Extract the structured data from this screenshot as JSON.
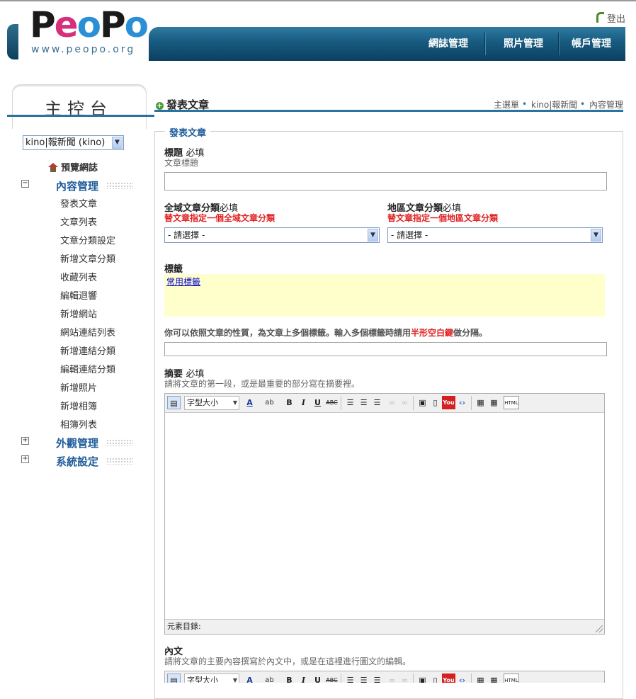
{
  "logo": {
    "word": [
      "P",
      "e",
      "o",
      "P",
      "o"
    ],
    "url": "www.peopo.org"
  },
  "header": {
    "logout": "登出",
    "nav": [
      "網誌管理",
      "照片管理",
      "帳戶管理"
    ]
  },
  "sidebar": {
    "title": "主控台",
    "blog_select": "kino|報新聞 (kino)",
    "preview": "預覽網誌",
    "sections": [
      {
        "label": "內容管理",
        "toggle": "−",
        "expanded": true
      },
      {
        "label": "外觀管理",
        "toggle": "+",
        "expanded": false
      },
      {
        "label": "系統設定",
        "toggle": "+",
        "expanded": false
      }
    ],
    "content_items": [
      "發表文章",
      "文章列表",
      "文章分類設定",
      "新增文章分類",
      "收藏列表",
      "編輯迴響",
      "新增網站",
      "網站連結列表",
      "新增連結分類",
      "編輯連結分類",
      "新增照片",
      "新增相簿",
      "相簿列表"
    ]
  },
  "main": {
    "title": "發表文章",
    "breadcrumb": [
      "主選單",
      "kino|報新聞",
      "內容管理"
    ],
    "form": {
      "legend": "發表文章",
      "title_label": "標題",
      "required": "必填",
      "title_hint": "文章標題",
      "title_value": "",
      "global_cat_label": "全域文章分類",
      "global_cat_hint": "替文章指定一個全域文章分類",
      "global_cat_value": "- 請選擇 -",
      "region_cat_label": "地區文章分類",
      "region_cat_hint": "替文章指定一個地區文章分類",
      "region_cat_value": "- 請選擇 -",
      "tags_label": "標籤",
      "common_tags": "常用標籤",
      "tags_note_a": "你可以依照文章的性質，為文章上多個標籤。輸入多個標籤時請用",
      "tags_note_em": "半形空白鍵",
      "tags_note_b": "做分隔。",
      "tags_value": "",
      "summary_label": "摘要",
      "summary_hint": "請將文章的第一段，或是最重要的部分寫在摘要裡。",
      "body_label": "內文",
      "body_hint": "請將文章的主要內容撰寫於內文中，或是在這裡進行圖文的編輯。"
    },
    "editor": {
      "font_size": "字型大小",
      "status": "元素目錄:",
      "buttons": {
        "bold": "B",
        "italic": "I",
        "underline": "U",
        "strike": "ABC",
        "html": "HTML"
      },
      "icons": [
        "source-icon",
        "font-color-icon",
        "highlight-icon",
        "bold-icon",
        "italic-icon",
        "underline-icon",
        "strikethrough-icon",
        "align-left-icon",
        "align-center-icon",
        "align-right-icon",
        "link-icon",
        "unlink-icon",
        "image-icon",
        "media-icon",
        "youtube-icon",
        "code-icon",
        "paste-text-icon",
        "paste-word-icon",
        "html-icon"
      ]
    }
  },
  "colors": {
    "nav": "#175a80",
    "accent": "#2a72a0",
    "link": "#1c5a9a",
    "required_red": "#e02020",
    "tag_bg": "#ffffcc"
  }
}
